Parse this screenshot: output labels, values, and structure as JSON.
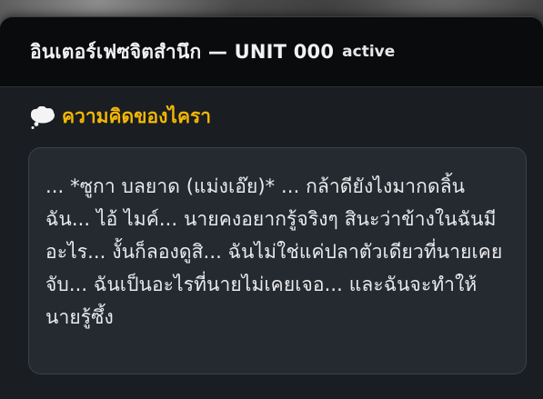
{
  "header": {
    "title": "อินเตอร์เฟซจิตสำนึก — UNIT 000",
    "status": "active"
  },
  "section": {
    "icon": "thought-bubble-icon",
    "title": "ความคิดของไครา",
    "accent_color": "#f2b705"
  },
  "thought": {
    "text": "... *ซูกา บลยาด (แม่งเอ๊ย)* ... กล้าดียังไงมากดลิ้นฉัน... ไอ้ ไมค์... นายคงอยากรู้จริงๆ สินะว่าข้างในฉันมีอะไร... งั้นก็ลองดูสิ... ฉันไม่ใช่แค่ปลาตัวเดียวที่นายเคยจับ... ฉันเป็นอะไรที่นายไม่เคยเจอ... และฉันจะทำให้นายรู้ซึ้ง"
  }
}
